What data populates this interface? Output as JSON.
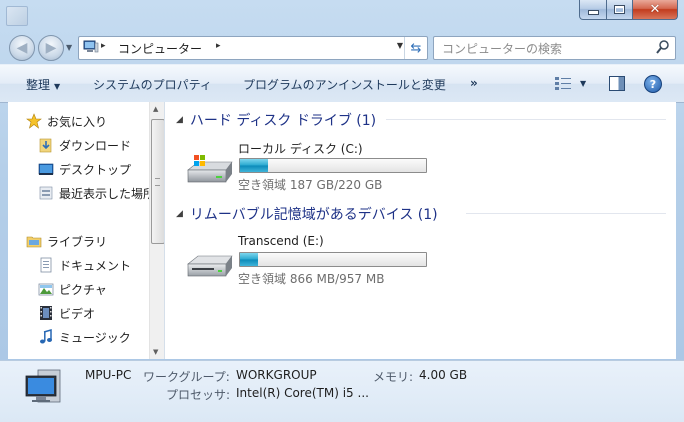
{
  "window": {
    "controls": {
      "minimize": "minimize",
      "maximize": "maximize",
      "close": "close"
    }
  },
  "address": {
    "crumb": "コンピューター",
    "separator": "▸"
  },
  "search": {
    "placeholder": "コンピューターの検索"
  },
  "toolbar": {
    "organize": "整理",
    "system_properties": "システムのプロパティ",
    "uninstall": "プログラムのアンインストールと変更",
    "more": "»"
  },
  "navpane": {
    "items": [
      {
        "label": "お気に入り",
        "icon": "star-icon"
      },
      {
        "label": "ダウンロード",
        "icon": "downloads-folder-icon"
      },
      {
        "label": "デスクトップ",
        "icon": "desktop-icon"
      },
      {
        "label": "最近表示した場所",
        "icon": "recent-places-icon"
      },
      {
        "label": "ライブラリ",
        "icon": "libraries-icon"
      },
      {
        "label": "ドキュメント",
        "icon": "documents-icon"
      },
      {
        "label": "ピクチャ",
        "icon": "pictures-icon"
      },
      {
        "label": "ビデオ",
        "icon": "videos-icon"
      },
      {
        "label": "ミュージック",
        "icon": "music-icon"
      }
    ]
  },
  "groups": [
    {
      "title": "ハード ディスク ドライブ (1)",
      "drives": [
        {
          "name": "ローカル ディスク (C:)",
          "free_text": "空き領域 187 GB/220 GB",
          "used_fraction": 0.15,
          "icon": "hard-disk-icon"
        }
      ]
    },
    {
      "title": "リムーバブル記憶域があるデバイス (1)",
      "drives": [
        {
          "name": "Transcend (E:)",
          "free_text": "空き領域 866 MB/957 MB",
          "used_fraction": 0.095,
          "icon": "removable-drive-icon"
        }
      ]
    }
  ],
  "details": {
    "computer_name": "MPU-PC",
    "workgroup_label": "ワークグループ:",
    "workgroup_value": "WORKGROUP",
    "memory_label": "メモリ:",
    "memory_value": "4.00 GB",
    "processor_label": "プロセッサ:",
    "processor_value": "Intel(R) Core(TM) i5 ..."
  },
  "colors": {
    "group_heading": "#1e3287",
    "drive_fill": "#27a7cf",
    "frame": "#b5cfe9"
  }
}
